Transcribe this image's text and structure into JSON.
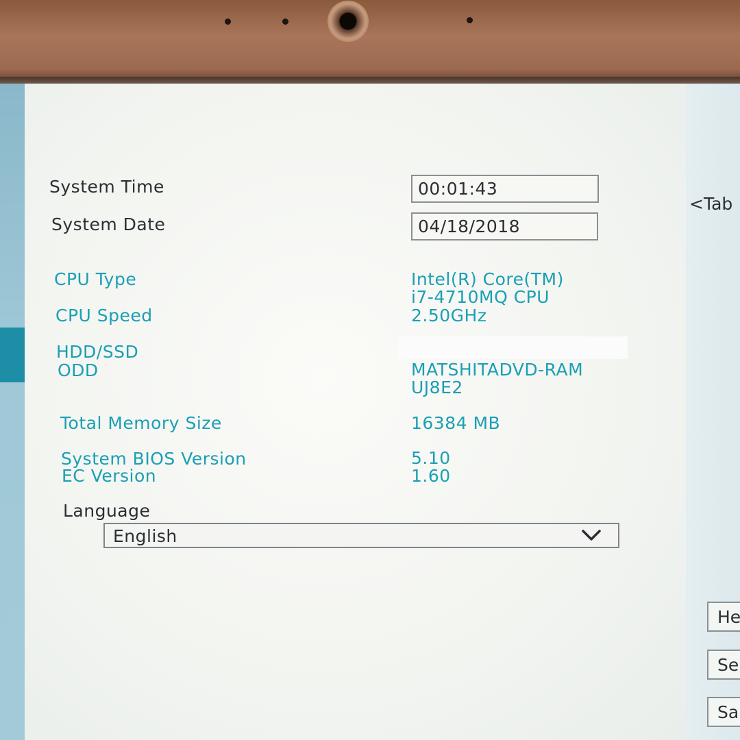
{
  "system": {
    "time_label": "System Time",
    "time_value": "00:01:43",
    "date_label": "System Date",
    "date_value": "04/18/2018"
  },
  "info": {
    "cpu_type_label": "CPU Type",
    "cpu_type_line1": "Intel(R) Core(TM)",
    "cpu_type_line2": "i7-4710MQ CPU",
    "cpu_speed_label": "CPU Speed",
    "cpu_speed_value": "2.50GHz",
    "hdd_label": "HDD/SSD",
    "odd_label": "ODD",
    "odd_line1": "MATSHITADVD-RAM",
    "odd_line2": "UJ8E2",
    "memory_label": "Total Memory Size",
    "memory_value": "16384 MB",
    "bios_label": "System BIOS Version",
    "bios_value": "5.10",
    "ec_label": "EC Version",
    "ec_value": "1.60"
  },
  "language": {
    "label": "Language",
    "selected": "English",
    "icon": "chevron-down-icon"
  },
  "right_panel": {
    "tab_hint": "<Tab",
    "buttons": [
      "He",
      "Se",
      "Sa"
    ]
  },
  "colors": {
    "accent_teal": "#1a9fb4",
    "text_dark": "#2b2f33",
    "nav_tab": "#1d8ea6",
    "bezel": "#a8755a"
  }
}
